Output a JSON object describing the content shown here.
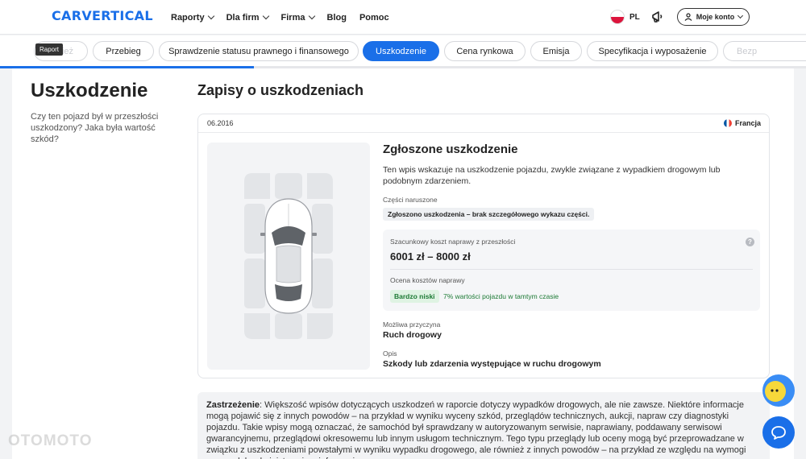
{
  "header": {
    "logo": "carVertical",
    "nav": [
      {
        "label": "Raporty",
        "dropdown": true
      },
      {
        "label": "Dla firm",
        "dropdown": true
      },
      {
        "label": "Firma",
        "dropdown": true
      },
      {
        "label": "Blog",
        "dropdown": false
      },
      {
        "label": "Pomoc",
        "dropdown": false
      }
    ],
    "language": "PL",
    "account_label": "Moje konto"
  },
  "tabs": {
    "items": [
      "Kradzież",
      "Przebieg",
      "Sprawdzenie statusu prawnego i finansowego",
      "Uszkodzenie",
      "Cena rynkowa",
      "Emisja",
      "Specyfikacja i wyposażenie",
      "Bezpieczeństwo"
    ],
    "first_visible": "ież",
    "last_visible": "Bezp",
    "active": "Uszkodzenie",
    "tooltip": "Raport"
  },
  "progress": {
    "percent": 31.5
  },
  "section": {
    "title": "Uszkodzenie",
    "description": "Czy ten pojazd był w przeszłości uszkodzony? Jaka była wartość szkód?"
  },
  "records": {
    "title": "Zapisy o uszkodzeniach",
    "card": {
      "date": "06.2016",
      "country": "Francja",
      "damage_title": "Zgłoszone uszkodzenie",
      "damage_description": "Ten wpis wskazuje na uszkodzenie pojazdu, zwykle związane z wypadkiem drogowym lub podobnym zdarzeniem.",
      "parts_label": "Części naruszone",
      "parts_value": "Zgłoszono uszkodzenia – brak szczegółowego wykazu części.",
      "cost_label": "Szacunkowy koszt naprawy z przeszłości",
      "cost_value": "6001 zł – 8000 zł",
      "help_glyph": "?",
      "evaluation_label": "Ocena kosztów naprawy",
      "evaluation_badge": "Bardzo niski",
      "evaluation_note": "7% wartości pojazdu w tamtym czasie",
      "cause_label": "Możliwa przyczyna",
      "cause_value": "Ruch drogowy",
      "desc_label": "Opis",
      "desc_value": "Szkody lub zdarzenia występujące w ruchu drogowym"
    }
  },
  "disclaimer": {
    "label": "Zastrzeżenie",
    "text": ": Większość wpisów dotyczących uszkodzeń w raporcie dotyczy wypadków drogowych, ale nie zawsze. Niektóre informacje mogą pojawić się z innych powodów – na przykład w wyniku wyceny szkód, przeglądów technicznych, aukcji, napraw czy diagnostyki pojazdu. Takie wpisy mogą oznaczać, że samochód był sprawdzany w autoryzowanym serwisie, naprawiany, poddawany serwisowi gwarancyjnemu, przeglądowi okresowemu lub innym usługom technicznym. Tego typu przeglądy lub oceny mogą być przeprowadzane w związku z uszkodzeniami powstałymi w wyniku wypadku drogowego, ale również z innych powodów – na przykład ze względu na wymogi prawne lub administracyjne, informacje"
  },
  "watermark": "OTOMOTO",
  "colors": {
    "accent": "#1a6fe8",
    "badge_green_bg": "#dff3e3",
    "badge_green_text": "#1d7a35"
  },
  "icons": {
    "lang_flag": "poland-flag-icon",
    "announce": "megaphone-icon",
    "account": "user-icon",
    "country_flag": "france-flag-icon",
    "chat": "chat-bubble-icon",
    "bot": "bot-avatar-icon"
  }
}
